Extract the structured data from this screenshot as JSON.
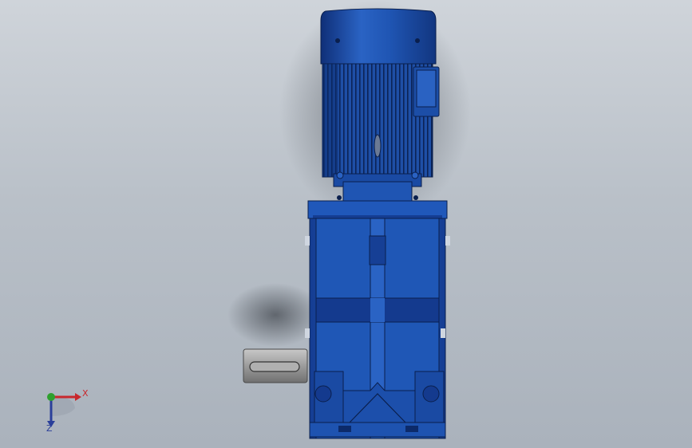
{
  "viewport": {
    "background_top": "#cfd4da",
    "background_bottom": "#aab2bc"
  },
  "model": {
    "description_color": "#1d4fa8",
    "shaft_color": "#a9a9a9"
  },
  "triad": {
    "x_label": "X",
    "z_label": "Z",
    "x_color": "#c8282d",
    "y_color": "#2ea02e",
    "z_color": "#2a3f9a"
  }
}
